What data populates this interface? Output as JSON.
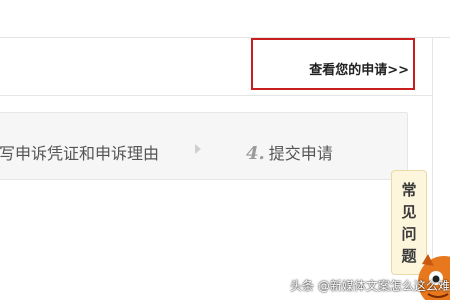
{
  "header": {
    "my_applications_link": "查看您的申请>>"
  },
  "steps": {
    "step3_label": "写申诉凭证和申诉理由",
    "step4_number": "4.",
    "step4_label": "提交申请"
  },
  "faq_tab": {
    "chars": [
      "常",
      "见",
      "问",
      "题"
    ]
  },
  "watermark": {
    "text": "头条 @新媒体文案怎么这么难"
  },
  "colors": {
    "highlight_border": "#c81e1e",
    "faq_background": "#fdf5dc",
    "mascot": "#e8781e"
  },
  "icons": {
    "step_arrow": "triangle-right-icon",
    "mascot": "mascot-character-icon"
  }
}
